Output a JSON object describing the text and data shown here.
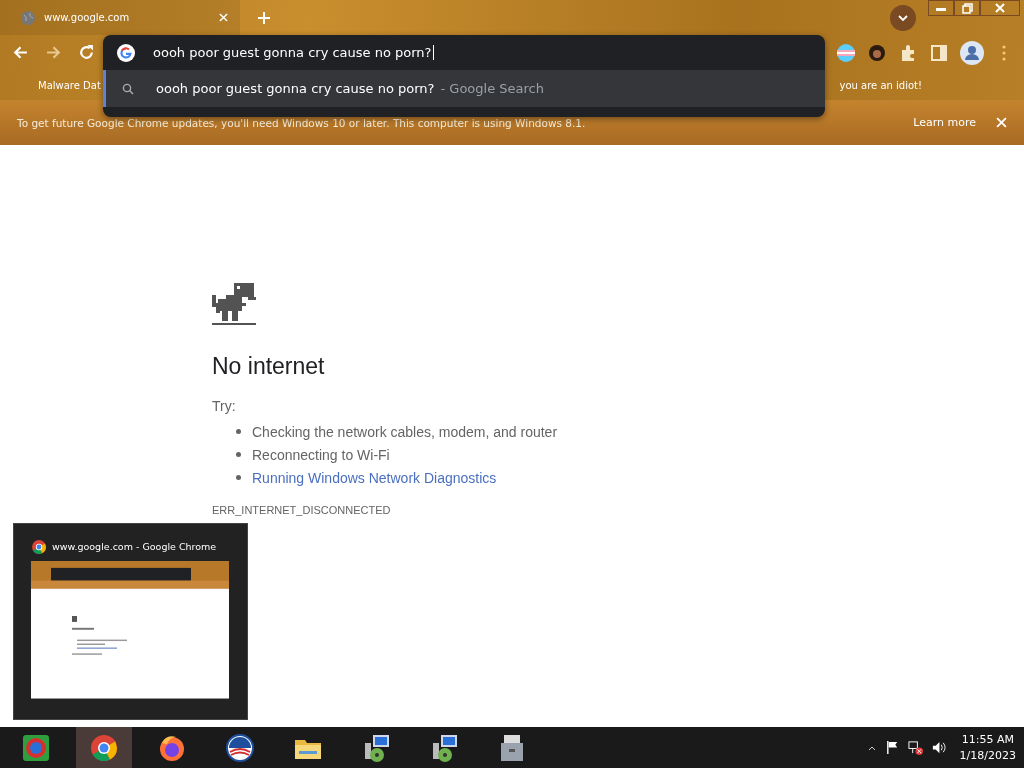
{
  "tab": {
    "title": "www.google.com",
    "selected": true
  },
  "omnibox": {
    "value": "oooh poor guest gonna cry cause no porn?",
    "suggestion": "oooh poor guest gonna cry cause no porn?",
    "suggestion_source": "- Google Search"
  },
  "bookmarks": [
    "Malware Dat",
    "you are an idiot!"
  ],
  "infobar": {
    "message": "To get future Google Chrome updates, you'll need Windows 10 or later. This computer is using Windows 8.1.",
    "link": "Learn more"
  },
  "error_page": {
    "title": "No internet",
    "try_label": "Try:",
    "suggestions": [
      {
        "text": "Checking the network cables, modem, and router",
        "kind": "text"
      },
      {
        "text": "Reconnecting to Wi-Fi",
        "kind": "text"
      },
      {
        "text": "Running Windows Network Diagnostics",
        "kind": "link"
      }
    ],
    "code": "ERR_INTERNET_DISCONNECTED"
  },
  "taskbar_preview": {
    "title": "www.google.com - Google Chrome"
  },
  "taskbar": {
    "apps": [
      {
        "kind": "start",
        "selected": false
      },
      {
        "kind": "chrome",
        "selected": true
      },
      {
        "kind": "firefox",
        "selected": false
      },
      {
        "kind": "round-logo",
        "selected": false
      },
      {
        "kind": "folder",
        "selected": false
      },
      {
        "kind": "installer",
        "selected": false
      },
      {
        "kind": "installer",
        "selected": false
      },
      {
        "kind": "toolbox",
        "selected": false
      }
    ],
    "time": "11:55 AM",
    "date": "1/18/2023"
  }
}
